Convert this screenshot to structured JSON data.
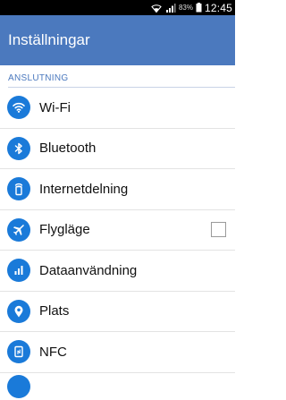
{
  "status_bar": {
    "battery_percent": "83%",
    "time": "12:45"
  },
  "app_bar": {
    "title": "Inställningar"
  },
  "section": {
    "header": "ANSLUTNING"
  },
  "items": [
    {
      "label": "Wi-Fi",
      "icon": "wifi-icon"
    },
    {
      "label": "Bluetooth",
      "icon": "bluetooth-icon"
    },
    {
      "label": "Internetdelning",
      "icon": "tethering-icon"
    },
    {
      "label": "Flygläge",
      "icon": "airplane-icon",
      "checkbox_checked": false
    },
    {
      "label": "Dataanvändning",
      "icon": "data-usage-icon"
    },
    {
      "label": "Plats",
      "icon": "location-icon"
    },
    {
      "label": "NFC",
      "icon": "nfc-icon"
    }
  ],
  "colors": {
    "accent": "#4b79be",
    "icon_bg": "#1a7ad9",
    "status_bar": "#000000"
  }
}
